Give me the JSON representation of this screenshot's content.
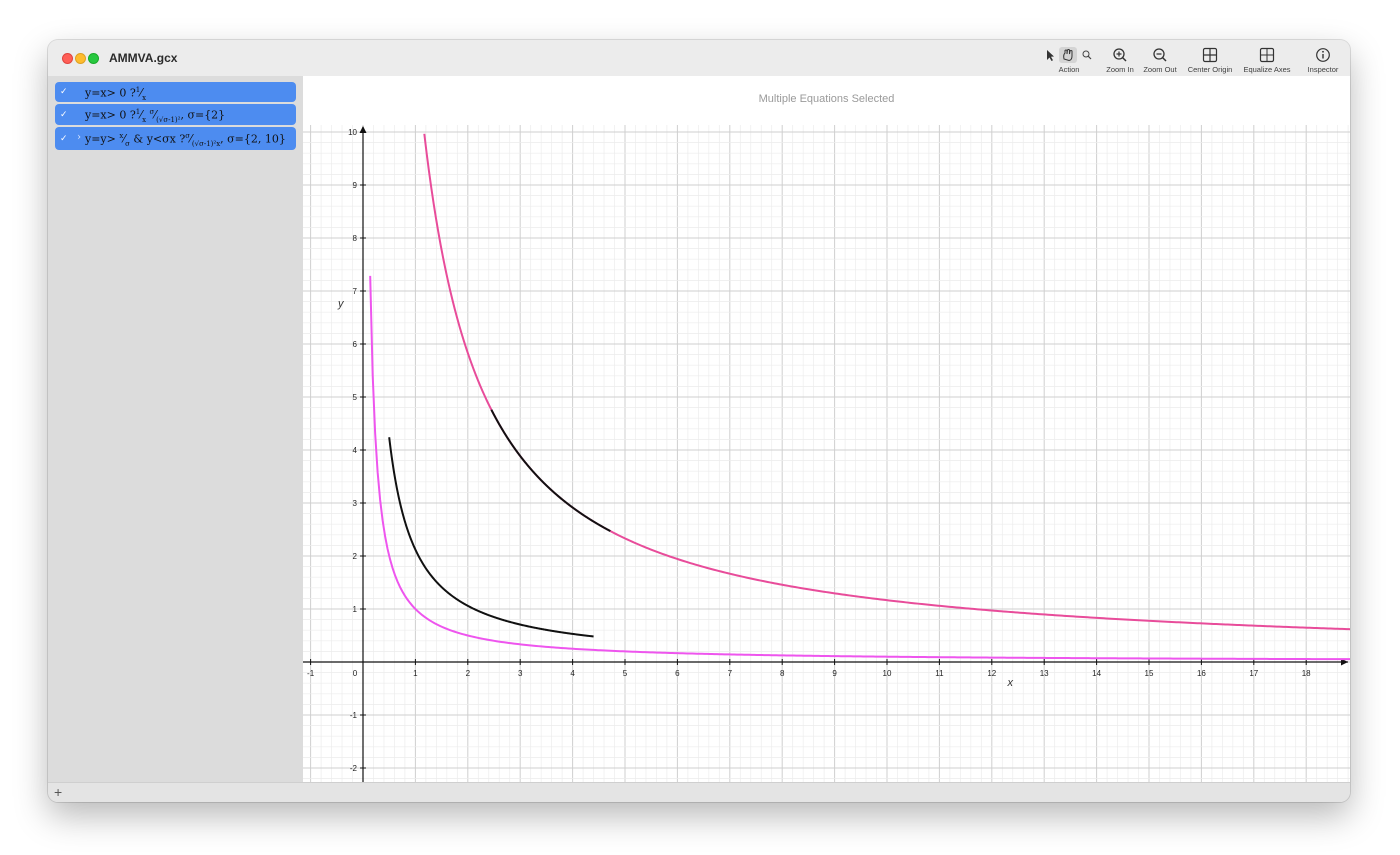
{
  "window": {
    "title": "AMMVA.gcx"
  },
  "toolbar": {
    "action_label": "Action",
    "zoom_in_label": "Zoom In",
    "zoom_out_label": "Zoom Out",
    "center_origin_label": "Center Origin",
    "equalize_axes_label": "Equalize Axes",
    "inspector_label": "Inspector"
  },
  "equations": [
    {
      "text": "y=x> 0 ?1/x",
      "checked": true
    },
    {
      "text": "y=x> 0 ?1/x σ/(√σ-1)², σ={2}",
      "checked": true
    },
    {
      "text": "y=y> x/σ & y<σx ?σ/((√σ-1)²x), σ={2,10}",
      "checked": true
    }
  ],
  "plot": {
    "title": "Multiple Equations Selected",
    "xlabel": "x",
    "ylabel": "y"
  },
  "chart_data": {
    "type": "line",
    "xlim": [
      -1.1,
      19
    ],
    "ylim": [
      -2.2,
      10.1
    ],
    "grid": true,
    "x_ticks": [
      -1,
      0,
      1,
      2,
      3,
      4,
      5,
      6,
      7,
      8,
      9,
      10,
      11,
      12,
      13,
      14,
      15,
      16,
      17,
      18
    ],
    "y_ticks": [
      -2,
      -1,
      1,
      2,
      3,
      4,
      5,
      6,
      7,
      8,
      9,
      10
    ],
    "colors": {
      "magenta": "#ee55ee",
      "pink": "#e84c9a",
      "black": "#111111"
    },
    "series": [
      {
        "color": "#ee55ee",
        "x_range": [
          0.09,
          19
        ],
        "formula": "1/x"
      },
      {
        "color": "#e84c9a",
        "x_range": [
          1.17,
          19
        ],
        "formula": "11.66/x"
      },
      {
        "color": "#111111",
        "x_range": [
          0.5,
          4.4
        ],
        "formula": "2.12/x"
      },
      {
        "color": "#111111",
        "x_range": [
          2.45,
          4.72
        ],
        "formula": "11.66/x"
      }
    ]
  }
}
